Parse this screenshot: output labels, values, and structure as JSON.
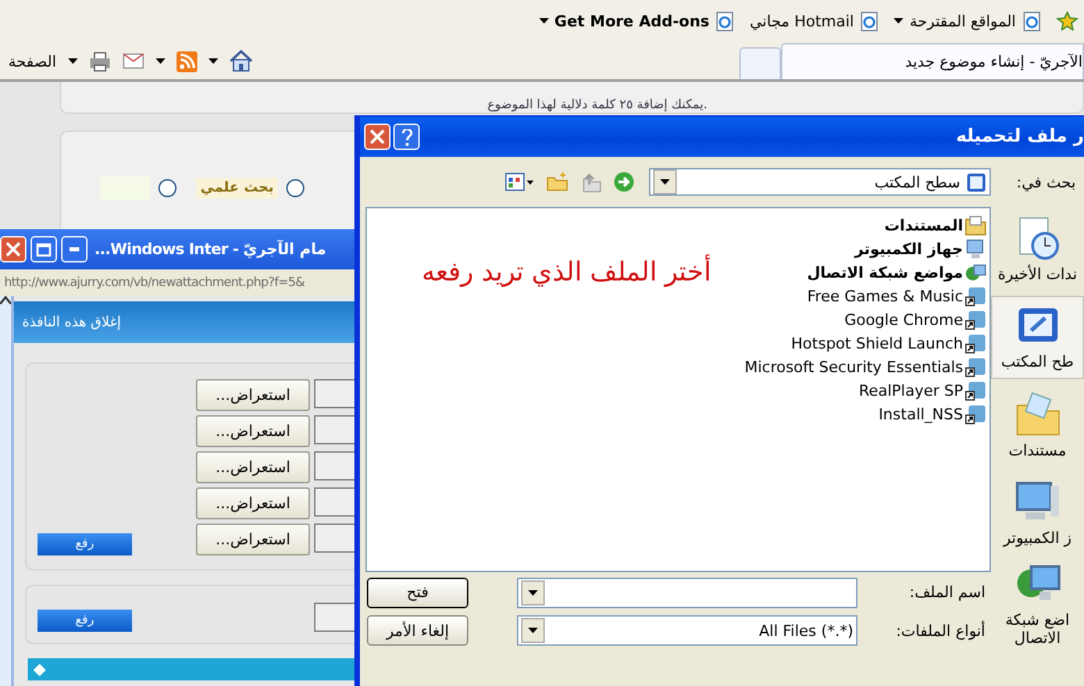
{
  "browser": {
    "links": [
      {
        "label": "المواقع المقترحة",
        "dropdown": true
      },
      {
        "label": "Hotmail مجاني",
        "dropdown": false
      },
      {
        "label": "Get More Add-ons",
        "dropdown": true
      }
    ],
    "page_menu": "الصفحة",
    "tab": {
      "title": "الآجريّ - إنشاء موضوع جديد"
    },
    "page": {
      "hint": "يمكنك إضافة ٢٥ كلمة دلالية لهذا الموضوع.",
      "options": [
        {
          "label": "بحث علمي",
          "selected": false
        },
        {
          "selected": false
        }
      ]
    }
  },
  "popup": {
    "title": "...Windows Inter - مام الآجريّ",
    "address": "http://www.ajurry.com/vb/newattachment.php?f=5&",
    "close_link": "إغلاق هذه النافذة",
    "browse_buttons": [
      "استعراض...",
      "استعراض...",
      "استعراض...",
      "استعراض...",
      "استعراض..."
    ],
    "upload_button": "رفع",
    "second_upload_button": "رفع"
  },
  "dialog": {
    "title": "ر ملف لتحميله",
    "look_in_label": "بحث في:",
    "look_in_value": "سطح المكتب",
    "places": [
      {
        "label": "ندات الأخيرة",
        "kind": "recent",
        "selected": false
      },
      {
        "label": "طح المكتب",
        "kind": "desktop",
        "selected": true
      },
      {
        "label": "مستندات",
        "kind": "documents",
        "selected": false
      },
      {
        "label": "ز الكمبيوتر",
        "kind": "computer",
        "selected": false
      },
      {
        "label": "اضع شبكة الاتصال",
        "kind": "network",
        "selected": false
      }
    ],
    "files": [
      {
        "name": "المستندات",
        "kind": "documents"
      },
      {
        "name": "جهاز الكمبيوتر",
        "kind": "computer"
      },
      {
        "name": "مواضع شبكة الاتصال",
        "kind": "network"
      },
      {
        "name": "Free Games & Music",
        "kind": "shortcut"
      },
      {
        "name": "Google Chrome",
        "kind": "shortcut"
      },
      {
        "name": "Hotspot Shield Launch",
        "kind": "shortcut"
      },
      {
        "name": "Microsoft Security Essentials",
        "kind": "shortcut"
      },
      {
        "name": "RealPlayer SP",
        "kind": "shortcut"
      },
      {
        "name": "Install_NSS",
        "kind": "shortcut"
      }
    ],
    "annotation": "أختر الملف الذي تريد رفعه",
    "file_name_label": "اسم الملف:",
    "file_type_label": "أنواع الملفات:",
    "file_type_value": "All Files (*.*)",
    "open_button": "فتح",
    "cancel_button": "إلغاء الأمر"
  }
}
